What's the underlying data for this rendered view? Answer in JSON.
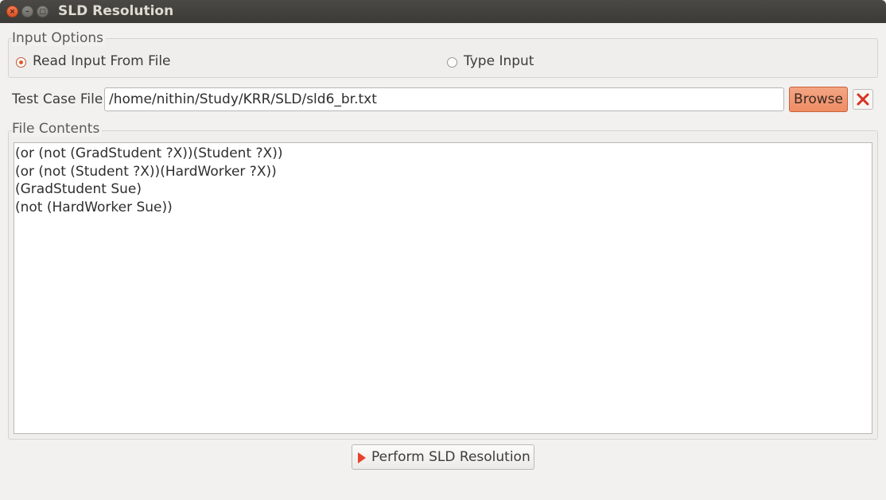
{
  "window": {
    "title": "SLD Resolution",
    "controls": {
      "close": "×",
      "minimize": "–",
      "maximize": "□"
    }
  },
  "input_options": {
    "legend": "Input Options",
    "options": [
      {
        "label": "Read Input From File",
        "selected": true
      },
      {
        "label": "Type Input",
        "selected": false
      }
    ]
  },
  "test_case": {
    "label": "Test Case File",
    "path": "/home/nithin/Study/KRR/SLD/sld6_br.txt",
    "browse_label": "Browse"
  },
  "file_contents": {
    "legend": "File Contents",
    "lines": [
      "(or (not (GradStudent ?X))(Student ?X))",
      "(or (not (Student ?X))(HardWorker ?X))",
      "(GradStudent Sue)",
      "(not (HardWorker Sue))"
    ]
  },
  "actions": {
    "perform_label": "Perform SLD Resolution"
  },
  "colors": {
    "accent": "#e05a2b",
    "browse_bg": "#f09a75",
    "titlebar": "#3c3b37",
    "clear_icon": "#d9321f"
  },
  "icons": {
    "clear": "close-x-icon",
    "perform": "play-icon"
  }
}
